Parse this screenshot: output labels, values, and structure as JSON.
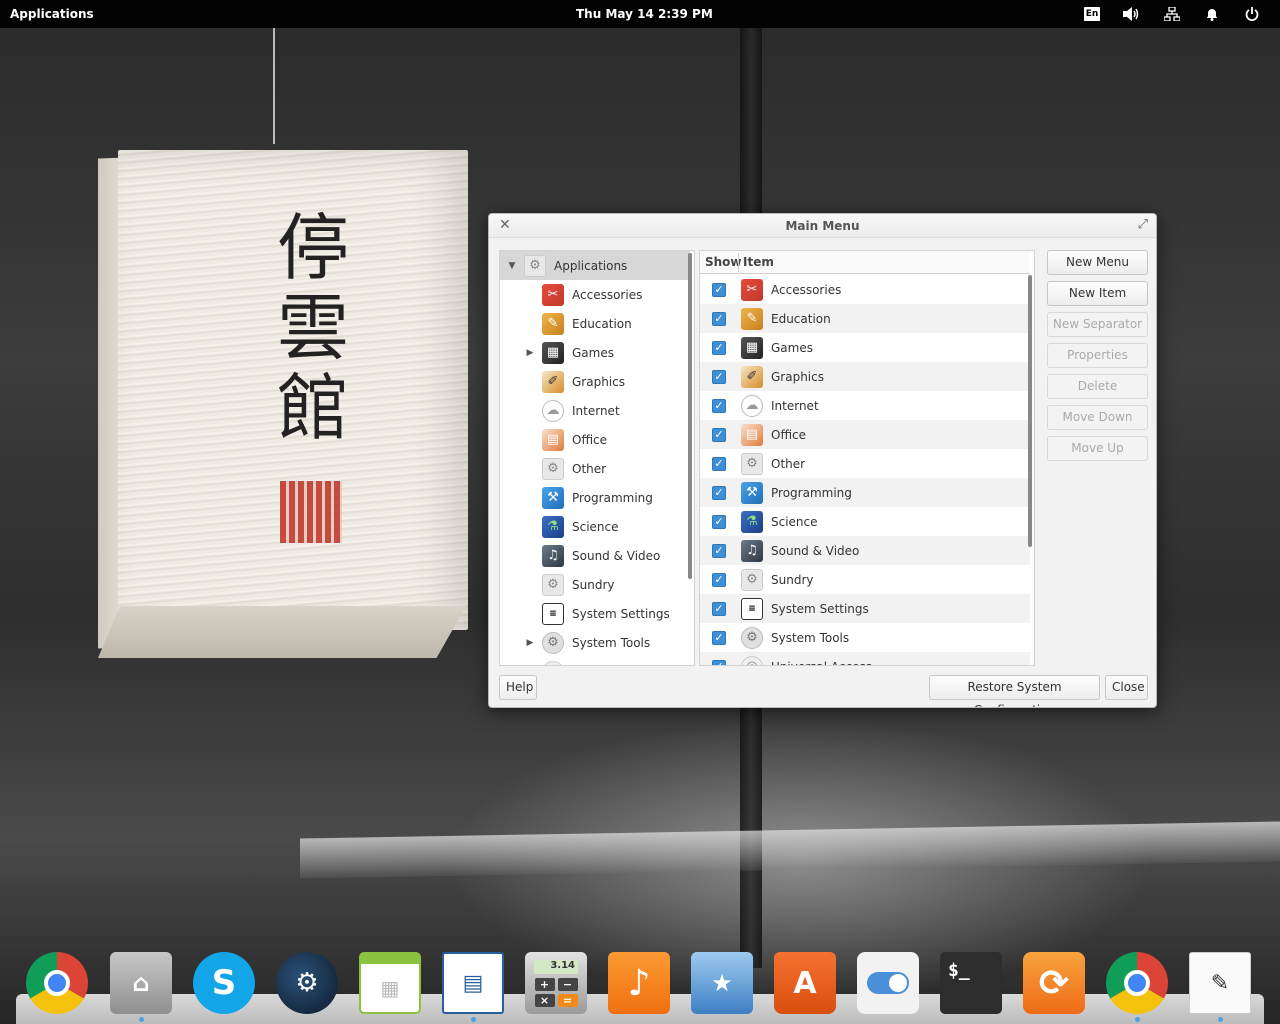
{
  "top_panel": {
    "applications_label": "Applications",
    "date": "Thu May 14",
    "time": "2:39 PM",
    "keyboard_layout": "En",
    "indicators": [
      "volume-icon",
      "network-icon",
      "notification-bell-icon",
      "power-icon"
    ]
  },
  "window": {
    "title": "Main Menu",
    "tree": {
      "items": [
        {
          "label": "Applications",
          "icon": "gear-icon",
          "expander": "▼",
          "selected": true
        },
        {
          "label": "Accessories",
          "icon": "accessories-icon",
          "expander": ""
        },
        {
          "label": "Education",
          "icon": "education-icon",
          "expander": ""
        },
        {
          "label": "Games",
          "icon": "games-icon",
          "expander": "▶"
        },
        {
          "label": "Graphics",
          "icon": "graphics-icon",
          "expander": ""
        },
        {
          "label": "Internet",
          "icon": "cloud-icon",
          "expander": ""
        },
        {
          "label": "Office",
          "icon": "office-icon",
          "expander": ""
        },
        {
          "label": "Other",
          "icon": "gear-icon",
          "expander": ""
        },
        {
          "label": "Programming",
          "icon": "programming-icon",
          "expander": ""
        },
        {
          "label": "Science",
          "icon": "flask-icon",
          "expander": ""
        },
        {
          "label": "Sound & Video",
          "icon": "sound-video-icon",
          "expander": ""
        },
        {
          "label": "Sundry",
          "icon": "gear-icon",
          "expander": ""
        },
        {
          "label": "System Settings",
          "icon": "settings-icon",
          "expander": ""
        },
        {
          "label": "System Tools",
          "icon": "system-tools-icon",
          "expander": "▶"
        },
        {
          "label": "Universal Access",
          "icon": "universal-access-icon",
          "expander": ""
        }
      ]
    },
    "list": {
      "header_show": "Show",
      "header_item": "Item",
      "items": [
        {
          "label": "Accessories",
          "icon": "accessories-icon",
          "checked": true
        },
        {
          "label": "Education",
          "icon": "education-icon",
          "checked": true
        },
        {
          "label": "Games",
          "icon": "games-icon",
          "checked": true
        },
        {
          "label": "Graphics",
          "icon": "graphics-icon",
          "checked": true
        },
        {
          "label": "Internet",
          "icon": "cloud-icon",
          "checked": true
        },
        {
          "label": "Office",
          "icon": "office-icon",
          "checked": true
        },
        {
          "label": "Other",
          "icon": "gear-icon",
          "checked": true
        },
        {
          "label": "Programming",
          "icon": "programming-icon",
          "checked": true
        },
        {
          "label": "Science",
          "icon": "flask-icon",
          "checked": true
        },
        {
          "label": "Sound & Video",
          "icon": "sound-video-icon",
          "checked": true
        },
        {
          "label": "Sundry",
          "icon": "gear-icon",
          "checked": true
        },
        {
          "label": "System Settings",
          "icon": "settings-icon",
          "checked": true
        },
        {
          "label": "System Tools",
          "icon": "system-tools-icon",
          "checked": true
        },
        {
          "label": "Universal Access",
          "icon": "universal-access-icon",
          "checked": true
        }
      ]
    },
    "buttons": {
      "new_menu": "New Menu",
      "new_item": "New Item",
      "new_separator": "New Separator",
      "properties": "Properties",
      "delete": "Delete",
      "move_down": "Move Down",
      "move_up": "Move Up",
      "help": "Help",
      "restore": "Restore System Configuration",
      "close": "Close"
    }
  },
  "dock": {
    "items": [
      "chrome-icon",
      "files-icon",
      "skype-icon",
      "steam-icon",
      "calendar-icon",
      "writer-icon",
      "calculator-icon",
      "music-icon",
      "photos-icon",
      "app-store-icon",
      "switchboard-icon",
      "terminal-icon",
      "sync-icon",
      "chrome-icon",
      "notes-icon"
    ],
    "calculator_display": "3.14",
    "skype_letter": "S",
    "store_letter": "A",
    "terminal_prompt": "$_"
  },
  "colors": {
    "accent": "#3d8fd6",
    "panel": "#000000",
    "window_bg": "#f2f2f2"
  }
}
